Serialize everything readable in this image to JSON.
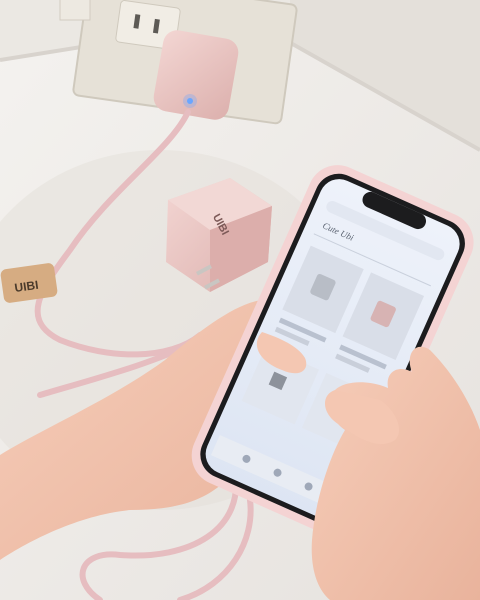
{
  "scene": {
    "description_label": "",
    "brand_text": "UIBI",
    "phone_screen": {
      "status_time": "",
      "url_bar": "",
      "store_logo": "Cute Ubi",
      "product_1_title": "",
      "product_1_price": "",
      "product_2_title": "",
      "product_2_price": ""
    }
  },
  "colors": {
    "wall": "#ece9e4",
    "sink": "#f3f1ee",
    "charger_pink": "#e9c6c4",
    "cable_pink": "#e8bcc0",
    "skin": "#f1c2ae",
    "phone_case": "#f5d6d6",
    "screen_bg": "#f2f5fb",
    "leather_tag": "#d7ae84"
  }
}
